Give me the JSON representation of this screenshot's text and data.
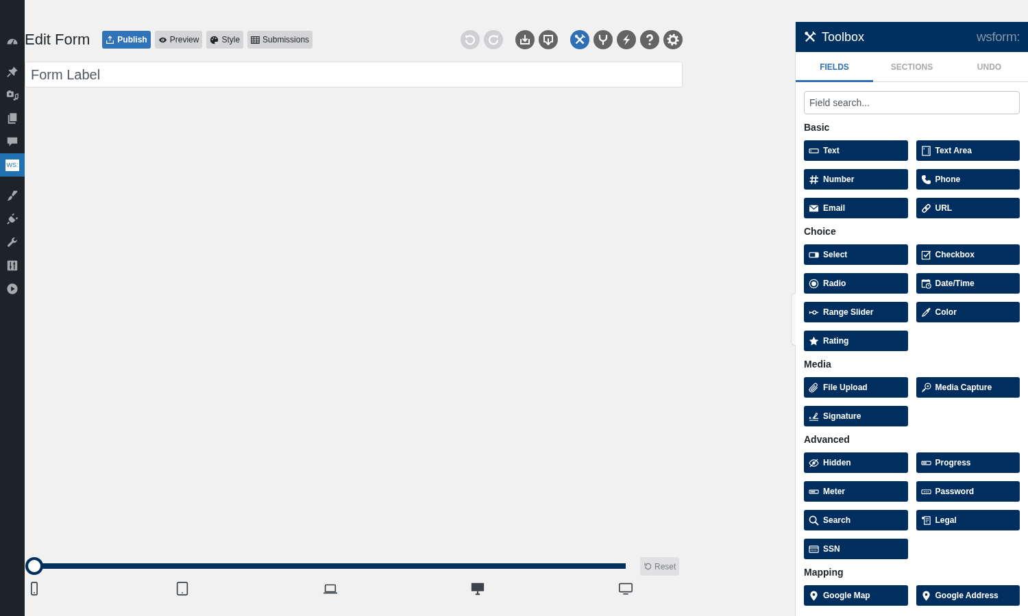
{
  "sidebar": {
    "groups": [
      {
        "items": [
          {
            "kind": "gauge",
            "selected": false
          }
        ]
      },
      {
        "items": [
          {
            "kind": "pin",
            "selected": false
          },
          {
            "kind": "media",
            "selected": false
          },
          {
            "kind": "pages",
            "selected": false
          },
          {
            "kind": "comment",
            "selected": false
          },
          {
            "kind": "logo",
            "label": "WS:",
            "selected": true
          }
        ]
      },
      {
        "items": [
          {
            "kind": "brush",
            "selected": false
          },
          {
            "kind": "plug",
            "selected": false
          },
          {
            "kind": "wrench",
            "selected": false
          },
          {
            "kind": "sliders",
            "selected": false
          },
          {
            "kind": "play",
            "selected": false
          }
        ]
      }
    ]
  },
  "header": {
    "title": "Edit Form",
    "buttons": [
      {
        "kind": "publish",
        "label": "Publish",
        "primary": true
      },
      {
        "kind": "preview",
        "label": "Preview",
        "primary": false
      },
      {
        "kind": "style",
        "label": "Style",
        "primary": false
      },
      {
        "kind": "submissions",
        "label": "Submissions",
        "primary": false
      }
    ],
    "icon_groups": [
      {
        "icons": [
          {
            "kind": "undo",
            "disabled": true,
            "selected": false
          },
          {
            "kind": "redo",
            "disabled": true,
            "selected": false
          }
        ]
      },
      {
        "icons": [
          {
            "kind": "import",
            "disabled": false,
            "selected": false
          },
          {
            "kind": "export",
            "disabled": false,
            "selected": false
          }
        ]
      },
      {
        "icons": [
          {
            "kind": "toolbox",
            "disabled": false,
            "selected": true
          },
          {
            "kind": "conditional",
            "disabled": false,
            "selected": false
          },
          {
            "kind": "actions",
            "disabled": false,
            "selected": false
          },
          {
            "kind": "help",
            "disabled": false,
            "selected": false
          },
          {
            "kind": "settings",
            "disabled": false,
            "selected": false
          }
        ]
      }
    ]
  },
  "form_label": {
    "value": "Form Label"
  },
  "breakpoints": {
    "level": 0,
    "devices": [
      {
        "kind": "phone"
      },
      {
        "kind": "tablet"
      },
      {
        "kind": "laptop"
      },
      {
        "kind": "desktop"
      },
      {
        "kind": "tv"
      }
    ],
    "reset": "Reset"
  },
  "toolbox": {
    "title": "Toolbox",
    "logo": "wsform:",
    "tabs": [
      {
        "label": "FIELDS",
        "selected": true
      },
      {
        "label": "SECTIONS",
        "selected": false
      },
      {
        "label": "UNDO",
        "selected": false
      }
    ],
    "search": {
      "placeholder": "Field search..."
    },
    "groups": [
      {
        "heading": "Basic",
        "fields": [
          {
            "kind": "text",
            "label": "Text"
          },
          {
            "kind": "textarea",
            "label": "Text Area"
          },
          {
            "kind": "number",
            "label": "Number"
          },
          {
            "kind": "phone",
            "label": "Phone"
          },
          {
            "kind": "email",
            "label": "Email"
          },
          {
            "kind": "url",
            "label": "URL"
          }
        ]
      },
      {
        "heading": "Choice",
        "fields": [
          {
            "kind": "select",
            "label": "Select"
          },
          {
            "kind": "checkbox",
            "label": "Checkbox"
          },
          {
            "kind": "radio",
            "label": "Radio"
          },
          {
            "kind": "datetime",
            "label": "Date/Time"
          },
          {
            "kind": "range",
            "label": "Range Slider"
          },
          {
            "kind": "color",
            "label": "Color"
          },
          {
            "kind": "rating",
            "label": "Rating"
          }
        ]
      },
      {
        "heading": "Media",
        "fields": [
          {
            "kind": "file",
            "label": "File Upload"
          },
          {
            "kind": "media",
            "label": "Media Capture"
          },
          {
            "kind": "signature",
            "label": "Signature"
          }
        ]
      },
      {
        "heading": "Advanced",
        "fields": [
          {
            "kind": "hidden",
            "label": "Hidden"
          },
          {
            "kind": "progress",
            "label": "Progress"
          },
          {
            "kind": "meter",
            "label": "Meter"
          },
          {
            "kind": "password",
            "label": "Password"
          },
          {
            "kind": "search",
            "label": "Search"
          },
          {
            "kind": "legal",
            "label": "Legal"
          },
          {
            "kind": "ssn",
            "label": "SSN"
          }
        ]
      },
      {
        "heading": "Mapping",
        "fields": [
          {
            "kind": "map",
            "label": "Google Map"
          },
          {
            "kind": "address",
            "label": "Google Address"
          }
        ]
      }
    ]
  }
}
